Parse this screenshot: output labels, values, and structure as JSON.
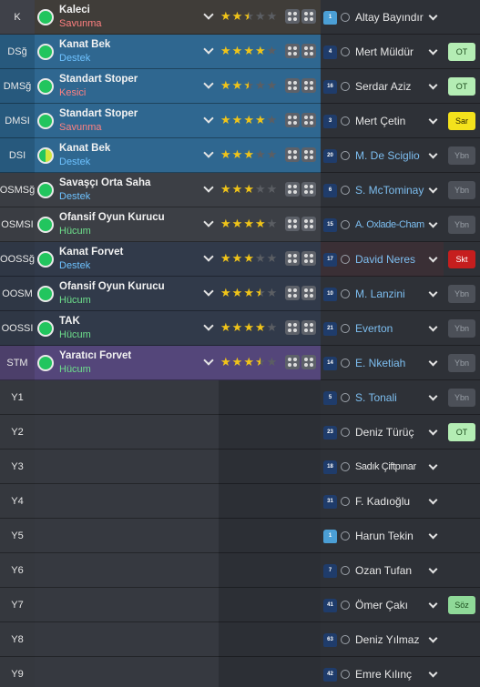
{
  "rows": [
    {
      "pos": "K",
      "role": "Kaleci",
      "duty": "Savunma",
      "duty_color": "red",
      "circle": "full",
      "stars": [
        1,
        1,
        0.5,
        0,
        0
      ],
      "number": "1",
      "gk": true,
      "player": "Altay Bayındır",
      "name_color": "white",
      "btn": "",
      "btn_type": "",
      "bg_pos": "#3f4149",
      "bg_main": "#403d39"
    },
    {
      "pos": "DSğ",
      "role": "Kanat Bek",
      "duty": "Destek",
      "duty_color": "blue",
      "circle": "full",
      "stars": [
        1,
        1,
        1,
        1,
        0
      ],
      "number": "4",
      "gk": false,
      "player": "Mert Müldür",
      "name_color": "white",
      "btn": "OT",
      "btn_type": "ot",
      "bg_pos": "#27597d",
      "bg_main": "#2f6790"
    },
    {
      "pos": "DMSğ",
      "role": "Standart Stoper",
      "duty": "Kesici",
      "duty_color": "red",
      "circle": "full",
      "stars": [
        1,
        1,
        0.5,
        0,
        0
      ],
      "number": "16",
      "gk": false,
      "player": "Serdar Aziz",
      "name_color": "white",
      "btn": "OT",
      "btn_type": "ot",
      "bg_pos": "#27597d",
      "bg_main": "#2f6790"
    },
    {
      "pos": "DMSI",
      "role": "Standart Stoper",
      "duty": "Savunma",
      "duty_color": "red",
      "circle": "full",
      "stars": [
        1,
        1,
        1,
        1,
        0
      ],
      "number": "3",
      "gk": false,
      "player": "Mert Çetin",
      "name_color": "white",
      "btn": "Sar",
      "btn_type": "sar",
      "bg_pos": "#27597d",
      "bg_main": "#2f6790"
    },
    {
      "pos": "DSI",
      "role": "Kanat Bek",
      "duty": "Destek",
      "duty_color": "blue",
      "circle": "half",
      "stars": [
        1,
        1,
        1,
        0,
        0
      ],
      "number": "20",
      "gk": false,
      "player": "M. De Sciglio",
      "name_color": "blue",
      "btn": "Ybn",
      "btn_type": "ybn",
      "bg_pos": "#27597d",
      "bg_main": "#2f6790"
    },
    {
      "pos": "OSMSğ",
      "role": "Savaşçı Orta Saha",
      "duty": "Destek",
      "duty_color": "blue",
      "circle": "full",
      "stars": [
        1,
        1,
        1,
        0,
        0
      ],
      "number": "6",
      "gk": false,
      "player": "S. McTominay",
      "name_color": "blue",
      "btn": "Ybn",
      "btn_type": "ybn",
      "bg_pos": "#3a3d43",
      "bg_main": "#3c3f45"
    },
    {
      "pos": "OSMSI",
      "role": "Ofansif Oyun Kurucu",
      "duty": "Hücum",
      "duty_color": "green",
      "circle": "full",
      "stars": [
        1,
        1,
        1,
        1,
        0
      ],
      "number": "15",
      "gk": false,
      "player": "A. Oxlade-Chamb...",
      "name_color": "blue",
      "btn": "Ybn",
      "btn_type": "ybn",
      "bg_pos": "#3a3d43",
      "bg_main": "#3c3f45"
    },
    {
      "pos": "OOSSğ",
      "role": "Kanat Forvet",
      "duty": "Destek",
      "duty_color": "blue",
      "circle": "full",
      "stars": [
        1,
        1,
        1,
        0,
        0
      ],
      "number": "17",
      "gk": false,
      "player": "David Neres",
      "name_color": "blue",
      "btn": "Skt",
      "btn_type": "skt",
      "bg_pos": "#2f3745",
      "bg_main": "#313a4a"
    },
    {
      "pos": "OOSM",
      "role": "Ofansif Oyun Kurucu",
      "duty": "Hücum",
      "duty_color": "green",
      "circle": "full",
      "stars": [
        1,
        1,
        1,
        0.5,
        0
      ],
      "number": "10",
      "gk": false,
      "player": "M. Lanzini",
      "name_color": "blue",
      "btn": "Ybn",
      "btn_type": "ybn",
      "bg_pos": "#2f3745",
      "bg_main": "#313a4a"
    },
    {
      "pos": "OOSSI",
      "role": "TAK",
      "duty": "Hücum",
      "duty_color": "green",
      "circle": "full",
      "stars": [
        1,
        1,
        1,
        1,
        0
      ],
      "number": "21",
      "gk": false,
      "player": "Everton",
      "name_color": "blue",
      "btn": "Ybn",
      "btn_type": "ybn",
      "bg_pos": "#2f3745",
      "bg_main": "#313a4a"
    },
    {
      "pos": "STM",
      "role": "Yaratıcı Forvet",
      "duty": "Hücum",
      "duty_color": "green",
      "circle": "full",
      "stars": [
        1,
        1,
        1,
        0.5,
        0
      ],
      "number": "14",
      "gk": false,
      "player": "E. Nketiah",
      "name_color": "blue",
      "btn": "Ybn",
      "btn_type": "ybn",
      "bg_pos": "#4c3f6a",
      "bg_main": "#54467a"
    },
    {
      "pos": "Y1",
      "number": "5",
      "gk": false,
      "player": "S. Tonali",
      "name_color": "blue",
      "btn": "Ybn",
      "btn_type": "ybn"
    },
    {
      "pos": "Y2",
      "number": "23",
      "gk": false,
      "player": "Deniz Türüç",
      "name_color": "white",
      "btn": "OT",
      "btn_type": "ot"
    },
    {
      "pos": "Y3",
      "number": "18",
      "gk": false,
      "player": "Sadık Çiftpınar",
      "name_color": "white",
      "btn": "",
      "btn_type": ""
    },
    {
      "pos": "Y4",
      "number": "31",
      "gk": false,
      "player": "F. Kadıoğlu",
      "name_color": "white",
      "btn": "",
      "btn_type": ""
    },
    {
      "pos": "Y5",
      "number": "1",
      "gk": true,
      "player": "Harun Tekin",
      "name_color": "white",
      "btn": "",
      "btn_type": ""
    },
    {
      "pos": "Y6",
      "number": "7",
      "gk": false,
      "player": "Ozan Tufan",
      "name_color": "white",
      "btn": "",
      "btn_type": ""
    },
    {
      "pos": "Y7",
      "number": "41",
      "gk": false,
      "player": "Ömer Çakı",
      "name_color": "white",
      "btn": "Söz",
      "btn_type": "soz"
    },
    {
      "pos": "Y8",
      "number": "63",
      "gk": false,
      "player": "Deniz Yılmaz",
      "name_color": "white",
      "btn": "",
      "btn_type": ""
    },
    {
      "pos": "Y9",
      "number": "42",
      "gk": false,
      "player": "Emre Kılınç",
      "name_color": "white",
      "btn": "",
      "btn_type": ""
    }
  ],
  "colors": {
    "sub_pos": "#35383e",
    "sub_role": "#363940",
    "sub_stars": "#2c2f35",
    "sub_player": "#2e3137",
    "player_col": "#2e3137",
    "star_on": "#f0c419",
    "duty_red": "#ff8080",
    "duty_blue": "#6ec2ff",
    "duty_green": "#6ee08c"
  },
  "icons": {
    "role_status": "green-circle-icon",
    "dropdown": "chevron-down-icon",
    "instructions": "tactics-dots-icon",
    "shirt": "shirt-number-icon",
    "player": "person-icon"
  }
}
